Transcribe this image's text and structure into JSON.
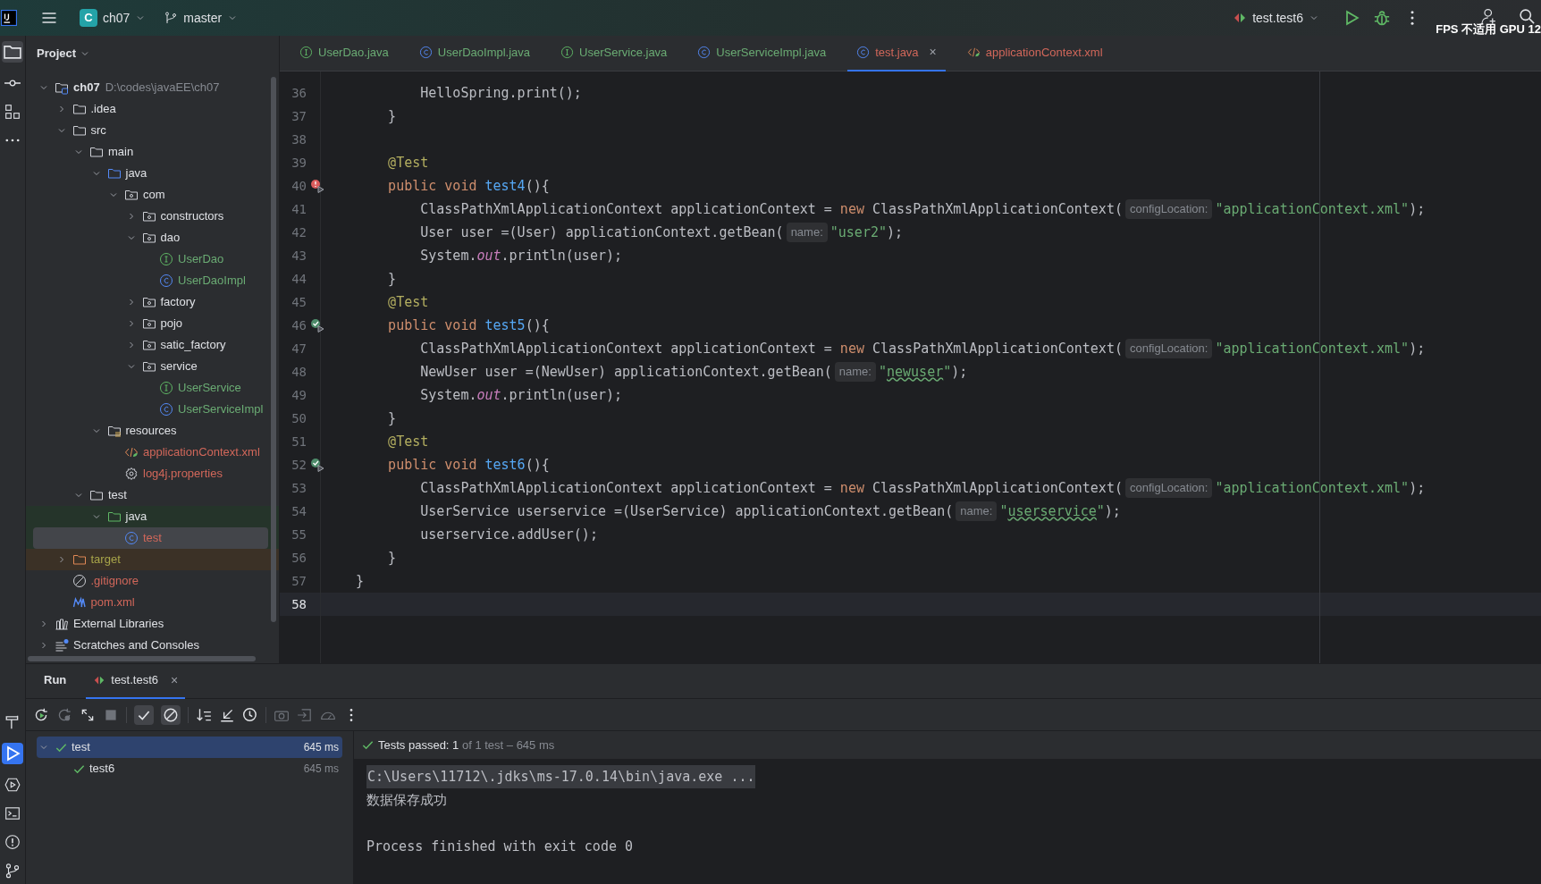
{
  "title_bar": {
    "project_badge": "C",
    "project": "ch07",
    "branch": "master",
    "run_config": "test.test6",
    "overlay": "FPS 不适用 GPU 12"
  },
  "project_panel": {
    "title": "Project",
    "tree": [
      {
        "label": "ch07",
        "path": "D:\\codes\\javaEE\\ch07",
        "kind": "module",
        "color": "#dfe1e5",
        "expanded": true,
        "selected": false,
        "children": [
          {
            "label": ".idea",
            "kind": "folder",
            "color": "#dfe1e5",
            "expanded": false,
            "selected": false
          },
          {
            "label": "src",
            "kind": "folder",
            "color": "#dfe1e5",
            "expanded": true,
            "selected": false,
            "children": [
              {
                "label": "main",
                "kind": "folder",
                "color": "#dfe1e5",
                "expanded": true,
                "selected": false,
                "children": [
                  {
                    "label": "java",
                    "kind": "source",
                    "color": "#dfe1e5",
                    "expanded": true,
                    "selected": false,
                    "children": [
                      {
                        "label": "com",
                        "kind": "package",
                        "color": "#dfe1e5",
                        "expanded": true,
                        "selected": false,
                        "children": [
                          {
                            "label": "constructors",
                            "kind": "package",
                            "color": "#dfe1e5",
                            "expanded": false,
                            "selected": false
                          },
                          {
                            "label": "dao",
                            "kind": "package",
                            "color": "#dfe1e5",
                            "expanded": true,
                            "selected": false,
                            "children": [
                              {
                                "label": "UserDao",
                                "kind": "interface",
                                "color": "#6aab73",
                                "selected": false
                              },
                              {
                                "label": "UserDaoImpl",
                                "kind": "class",
                                "color": "#6aab73",
                                "selected": false
                              }
                            ]
                          },
                          {
                            "label": "factory",
                            "kind": "package",
                            "color": "#dfe1e5",
                            "expanded": false,
                            "selected": false
                          },
                          {
                            "label": "pojo",
                            "kind": "package",
                            "color": "#dfe1e5",
                            "expanded": false,
                            "selected": false
                          },
                          {
                            "label": "satic_factory",
                            "kind": "package",
                            "color": "#dfe1e5",
                            "expanded": false,
                            "selected": false
                          },
                          {
                            "label": "service",
                            "kind": "package",
                            "color": "#dfe1e5",
                            "expanded": true,
                            "selected": false,
                            "children": [
                              {
                                "label": "UserService",
                                "kind": "interface",
                                "color": "#6aab73",
                                "selected": false
                              },
                              {
                                "label": "UserServiceImpl",
                                "kind": "class",
                                "color": "#6aab73",
                                "selected": false
                              }
                            ]
                          }
                        ]
                      }
                    ]
                  },
                  {
                    "label": "resources",
                    "kind": "resources",
                    "color": "#dfe1e5",
                    "expanded": true,
                    "selected": false,
                    "children": [
                      {
                        "label": "applicationContext.xml",
                        "kind": "xml",
                        "color": "#d1675a",
                        "selected": false
                      },
                      {
                        "label": "log4j.properties",
                        "kind": "properties",
                        "color": "#d1675a",
                        "selected": false
                      }
                    ]
                  }
                ]
              },
              {
                "label": "test",
                "kind": "folder",
                "color": "#dfe1e5",
                "expanded": true,
                "selected": false,
                "children": [
                  {
                    "label": "java",
                    "kind": "test_source",
                    "color": "#dfe1e5",
                    "expanded": true,
                    "selected": false,
                    "children": [
                      {
                        "label": "test",
                        "kind": "class",
                        "color": "#d1675a",
                        "selected": true
                      }
                    ]
                  }
                ]
              }
            ]
          },
          {
            "label": "target",
            "kind": "excluded",
            "color": "#a8a54a",
            "expanded": false,
            "selected": false
          },
          {
            "label": ".gitignore",
            "kind": "ignore",
            "color": "#d1675a",
            "selected": false
          },
          {
            "label": "pom.xml",
            "kind": "maven",
            "color": "#d1675a",
            "selected": false
          }
        ]
      },
      {
        "label": "External Libraries",
        "kind": "library",
        "color": "#dfe1e5",
        "expanded": false,
        "selected": false
      },
      {
        "label": "Scratches and Consoles",
        "kind": "scratches",
        "color": "#dfe1e5",
        "expanded": false,
        "selected": false
      }
    ]
  },
  "editor_tabs": [
    {
      "label": "UserDao.java",
      "kind": "interface",
      "color": "#6aab73",
      "selected": false
    },
    {
      "label": "UserDaoImpl.java",
      "kind": "class",
      "color": "#6aab73",
      "selected": false
    },
    {
      "label": "UserService.java",
      "kind": "interface",
      "color": "#6aab73",
      "selected": false
    },
    {
      "label": "UserServiceImpl.java",
      "kind": "class",
      "color": "#6aab73",
      "selected": false
    },
    {
      "label": "test.java",
      "kind": "class",
      "color": "#d1675a",
      "selected": true,
      "close": "×"
    },
    {
      "label": "applicationContext.xml",
      "kind": "xml",
      "color": "#d1675a",
      "selected": false
    }
  ],
  "code_lines": [
    {
      "number": "36",
      "kind": "plain",
      "current": false,
      "tokens": [
        {
          "kind": "plain",
          "text": "        HelloSpring.print();"
        }
      ]
    },
    {
      "number": "37",
      "kind": "plain",
      "current": false,
      "tokens": [
        {
          "kind": "plain",
          "text": "    }"
        }
      ]
    },
    {
      "number": "38",
      "kind": "plain",
      "current": false
    },
    {
      "number": "39",
      "kind": "plain",
      "current": false,
      "tokens": [
        {
          "kind": "annotation",
          "text": "    @Test"
        }
      ]
    },
    {
      "number": "40",
      "kind": "test_failed",
      "current": false,
      "tokens": [
        {
          "kind": "keyword",
          "text": "    public void "
        },
        {
          "kind": "method",
          "text": "test4"
        },
        {
          "kind": "plain",
          "text": "(){"
        }
      ]
    },
    {
      "number": "41",
      "kind": "plain",
      "current": false,
      "tokens": [
        {
          "kind": "plain",
          "text": "        ClassPathXmlApplicationContext applicationContext = "
        },
        {
          "kind": "keyword",
          "text": "new"
        },
        {
          "kind": "plain",
          "text": " ClassPathXmlApplicationContext("
        },
        {
          "kind": "hint",
          "text": "configLocation:"
        },
        {
          "kind": "string",
          "text": "\"applicationContext.xml\""
        },
        {
          "kind": "plain",
          "text": ");"
        }
      ]
    },
    {
      "number": "42",
      "kind": "plain",
      "current": false,
      "tokens": [
        {
          "kind": "plain",
          "text": "        User user =(User) applicationContext.getBean("
        },
        {
          "kind": "hint",
          "text": "name:"
        },
        {
          "kind": "string",
          "text": "\"user2\""
        },
        {
          "kind": "plain",
          "text": ");"
        }
      ]
    },
    {
      "number": "43",
      "kind": "plain",
      "current": false,
      "tokens": [
        {
          "kind": "plain",
          "text": "        System."
        },
        {
          "kind": "static",
          "text": "out"
        },
        {
          "kind": "plain",
          "text": ".println(user);"
        }
      ]
    },
    {
      "number": "44",
      "kind": "plain",
      "current": false,
      "tokens": [
        {
          "kind": "plain",
          "text": "    }"
        }
      ]
    },
    {
      "number": "45",
      "kind": "plain",
      "current": false,
      "tokens": [
        {
          "kind": "annotation",
          "text": "    @Test"
        }
      ]
    },
    {
      "number": "46",
      "kind": "test_passed",
      "current": false,
      "tokens": [
        {
          "kind": "keyword",
          "text": "    public void "
        },
        {
          "kind": "method",
          "text": "test5"
        },
        {
          "kind": "plain",
          "text": "(){"
        }
      ]
    },
    {
      "number": "47",
      "kind": "plain",
      "current": false,
      "tokens": [
        {
          "kind": "plain",
          "text": "        ClassPathXmlApplicationContext applicationContext = "
        },
        {
          "kind": "keyword",
          "text": "new"
        },
        {
          "kind": "plain",
          "text": " ClassPathXmlApplicationContext("
        },
        {
          "kind": "hint",
          "text": "configLocation:"
        },
        {
          "kind": "string",
          "text": "\"applicationContext.xml\""
        },
        {
          "kind": "plain",
          "text": ");"
        }
      ]
    },
    {
      "number": "48",
      "kind": "plain",
      "current": false,
      "tokens": [
        {
          "kind": "plain",
          "text": "        NewUser user =(NewUser) applicationContext.getBean("
        },
        {
          "kind": "hint",
          "text": "name:"
        },
        {
          "kind": "string",
          "text": "\""
        },
        {
          "kind": "typo",
          "text": "newuser"
        },
        {
          "kind": "string",
          "text": "\""
        },
        {
          "kind": "plain",
          "text": ");"
        }
      ]
    },
    {
      "number": "49",
      "kind": "plain",
      "current": false,
      "tokens": [
        {
          "kind": "plain",
          "text": "        System."
        },
        {
          "kind": "static",
          "text": "out"
        },
        {
          "kind": "plain",
          "text": ".println(user);"
        }
      ]
    },
    {
      "number": "50",
      "kind": "plain",
      "current": false,
      "tokens": [
        {
          "kind": "plain",
          "text": "    }"
        }
      ]
    },
    {
      "number": "51",
      "kind": "plain",
      "current": false,
      "tokens": [
        {
          "kind": "annotation",
          "text": "    @Test"
        }
      ]
    },
    {
      "number": "52",
      "kind": "test_passed",
      "current": false,
      "tokens": [
        {
          "kind": "keyword",
          "text": "    public void "
        },
        {
          "kind": "method",
          "text": "test6"
        },
        {
          "kind": "plain",
          "text": "(){"
        }
      ]
    },
    {
      "number": "53",
      "kind": "plain",
      "current": false,
      "tokens": [
        {
          "kind": "plain",
          "text": "        ClassPathXmlApplicationContext applicationContext = "
        },
        {
          "kind": "keyword",
          "text": "new"
        },
        {
          "kind": "plain",
          "text": " ClassPathXmlApplicationContext("
        },
        {
          "kind": "hint",
          "text": "configLocation:"
        },
        {
          "kind": "string",
          "text": "\"applicationContext.xml\""
        },
        {
          "kind": "plain",
          "text": ");"
        }
      ]
    },
    {
      "number": "54",
      "kind": "plain",
      "current": false,
      "tokens": [
        {
          "kind": "plain",
          "text": "        UserService userservice =(UserService) applicationContext.getBean("
        },
        {
          "kind": "hint",
          "text": "name:"
        },
        {
          "kind": "string",
          "text": "\""
        },
        {
          "kind": "typo",
          "text": "userservice"
        },
        {
          "kind": "string",
          "text": "\""
        },
        {
          "kind": "plain",
          "text": ");"
        }
      ]
    },
    {
      "number": "55",
      "kind": "plain",
      "current": false,
      "tokens": [
        {
          "kind": "plain",
          "text": "        userservice.addUser();"
        }
      ]
    },
    {
      "number": "56",
      "kind": "plain",
      "current": false,
      "tokens": [
        {
          "kind": "plain",
          "text": "    }"
        }
      ]
    },
    {
      "number": "57",
      "kind": "plain",
      "current": false,
      "tokens": [
        {
          "kind": "plain",
          "text": "}"
        }
      ]
    },
    {
      "number": "58",
      "kind": "plain",
      "current": true
    }
  ],
  "run_panel": {
    "tabs": [
      {
        "label": "Run",
        "kind": "title",
        "selected": false
      },
      {
        "label": "test.test6",
        "kind": "config",
        "selected": true,
        "close": "×"
      }
    ],
    "results": [
      {
        "label": "test",
        "time": "645 ms",
        "passed": true,
        "expanded": true,
        "selected": true,
        "children": [
          {
            "label": "test6",
            "time": "645 ms",
            "passed": true,
            "selected": false
          }
        ]
      }
    ],
    "summary": {
      "status": "Tests passed: ",
      "count": "1",
      "detail": "of 1 test – 645 ms"
    },
    "console": [
      {
        "kind": "command",
        "text": "C:\\Users\\11712\\.jdks\\ms-17.0.14\\bin\\java.exe ..."
      },
      {
        "kind": "output",
        "text": "数据保存成功"
      },
      {
        "kind": "blank"
      },
      {
        "kind": "output",
        "text": "Process finished with exit code 0"
      }
    ]
  }
}
